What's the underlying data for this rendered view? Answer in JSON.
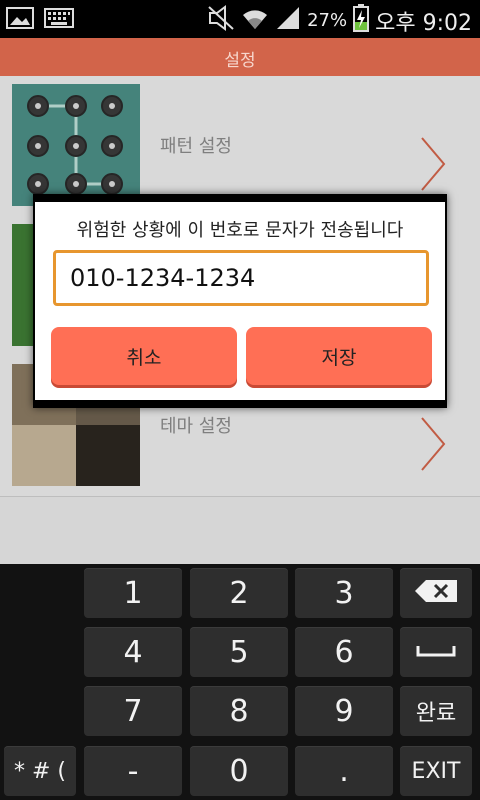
{
  "status_bar": {
    "battery_percent": "27%",
    "time": "오후 9:02",
    "icons": [
      "gallery-icon",
      "keyboard-icon",
      "mute-icon",
      "wifi-icon",
      "signal-icon",
      "battery-charging-icon"
    ]
  },
  "app_bar": {
    "title": "설정"
  },
  "list": {
    "items": [
      {
        "label": "패턴 설정"
      },
      {
        "label": ""
      },
      {
        "label": "테마 설정"
      }
    ]
  },
  "dialog": {
    "message": "위험한 상황에 이 번호로 문자가 전송됩니다",
    "phone_value": "010-1234-1234",
    "cancel_label": "취소",
    "save_label": "저장"
  },
  "keyboard": {
    "keys": {
      "k1": "1",
      "k2": "2",
      "k3": "3",
      "k4": "4",
      "k5": "5",
      "k6": "6",
      "k7": "7",
      "k8": "8",
      "k9": "9",
      "symbols": "* # (",
      "dash": "-",
      "k0": "0",
      "dot": ".",
      "done": "완료",
      "exit": "EXIT"
    }
  },
  "colors": {
    "app_bar": "#d2644a",
    "dialog_button": "#ff6f55",
    "input_border": "#e7962e",
    "keyboard_bg": "#121212",
    "key_bg": "#2e2e2e"
  }
}
